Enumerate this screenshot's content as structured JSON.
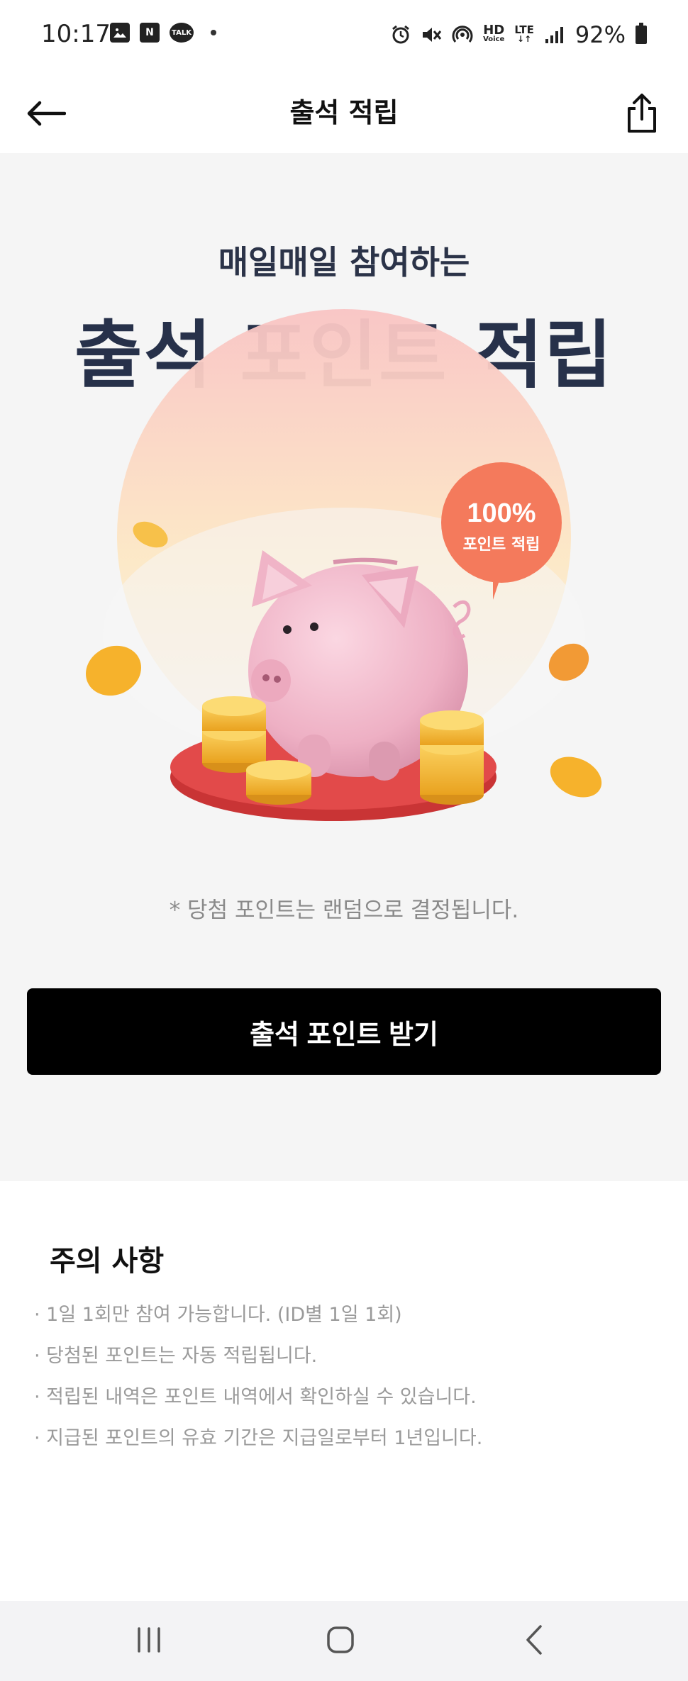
{
  "status_bar": {
    "time": "10:17",
    "battery": "92%",
    "icons_left": [
      "gallery-icon",
      "naver-icon",
      "kakaotalk-icon"
    ],
    "kakao_label": "TALK",
    "naver_label": "N",
    "hd_label": "HD",
    "voice_label": "Voice",
    "lte_label": "LTE"
  },
  "app_bar": {
    "title": "출석 적립"
  },
  "hero": {
    "subtitle": "매일매일 참여하는",
    "title": "출석 포인트 적립",
    "badge_percent": "100%",
    "badge_text": "포인트 적립",
    "note": "* 당첨 포인트는 랜덤으로 결정됩니다."
  },
  "cta": {
    "label": "출석 포인트 받기"
  },
  "notice": {
    "title": "주의 사항",
    "items": [
      "· 1일 1회만 참여 가능합니다. (ID별 1일 1회)",
      "· 당첨된 포인트는 자동 적립됩니다.",
      "· 적립된 내역은 포인트 내역에서 확인하실 수 있습니다.",
      "· 지급된 포인트의 유효 기간은 지급일로부터 1년입니다."
    ]
  },
  "colors": {
    "cta_bg": "#000000",
    "hero_bg": "#f5f5f5",
    "title_text": "#27314a",
    "badge": "#f47a5c"
  }
}
